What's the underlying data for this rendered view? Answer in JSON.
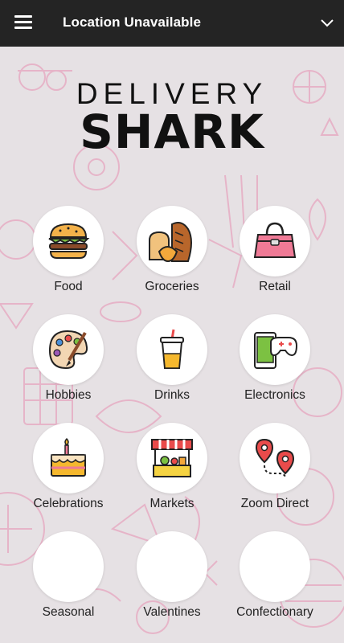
{
  "header": {
    "title": "Location Unavailable"
  },
  "logo": {
    "line1": "DELIVERY",
    "line2": "SHARK"
  },
  "categories": [
    {
      "label": "Food",
      "icon": "burger-icon"
    },
    {
      "label": "Groceries",
      "icon": "bread-icon"
    },
    {
      "label": "Retail",
      "icon": "handbag-icon"
    },
    {
      "label": "Hobbies",
      "icon": "palette-icon"
    },
    {
      "label": "Drinks",
      "icon": "drink-cup-icon"
    },
    {
      "label": "Electronics",
      "icon": "phone-gamepad-icon"
    },
    {
      "label": "Celebrations",
      "icon": "birthday-cake-icon"
    },
    {
      "label": "Markets",
      "icon": "market-stall-icon"
    },
    {
      "label": "Zoom Direct",
      "icon": "route-pins-icon"
    },
    {
      "label": "Seasonal",
      "icon": ""
    },
    {
      "label": "Valentines",
      "icon": ""
    },
    {
      "label": "Confectionary",
      "icon": ""
    }
  ],
  "colors": {
    "topbar": "#242424",
    "background": "#e6e1e4",
    "doodle": "#e7a6bf"
  }
}
